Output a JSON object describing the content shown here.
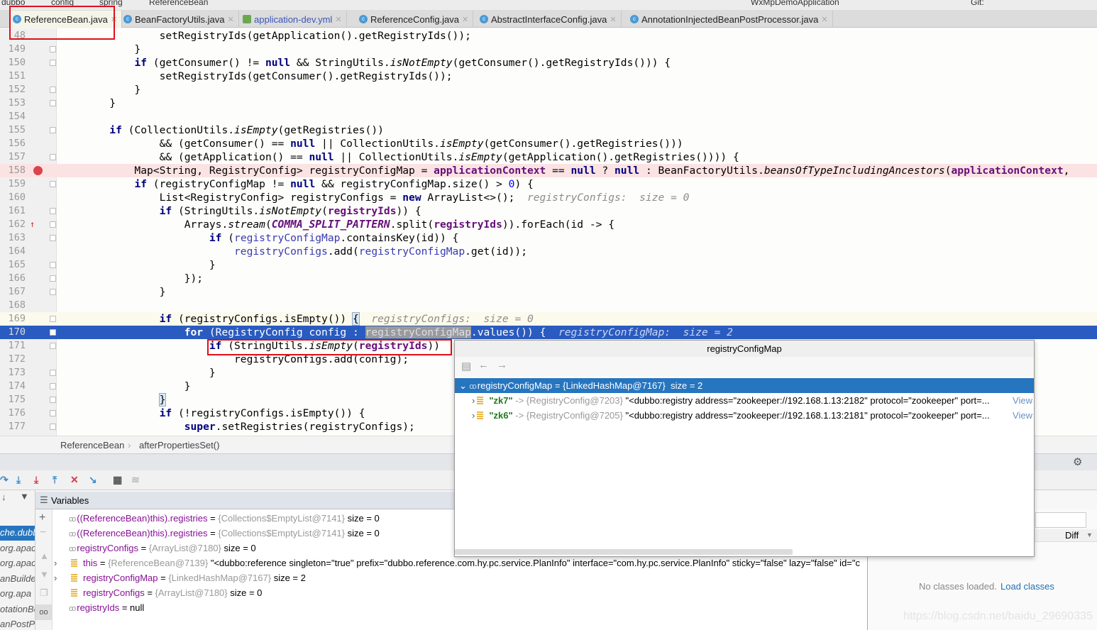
{
  "top_breadcrumb": [
    "dubbo",
    "config",
    "spring",
    "ReferenceBean"
  ],
  "run_config": "WxMpDemoApplication",
  "git_label": "Git:",
  "tabs": [
    {
      "label": "ReferenceBean.java",
      "active": true,
      "type": "class"
    },
    {
      "label": "BeanFactoryUtils.java",
      "type": "class"
    },
    {
      "label": "application-dev.yml",
      "type": "yml"
    },
    {
      "label": "ReferenceConfig.java",
      "type": "class"
    },
    {
      "label": "AbstractInterfaceConfig.java",
      "type": "class"
    },
    {
      "label": "AnnotationInjectedBeanPostProcessor.java",
      "type": "class"
    }
  ],
  "editor": {
    "execution_line": 170,
    "breakpoint_line": 158,
    "caret_line": 169,
    "lines": [
      {
        "n": "48",
        "t": [
          [
            "",
            "                setRegistryIds(getApplication().getRegistryIds());"
          ]
        ]
      },
      {
        "n": "149",
        "t": [
          [
            "",
            "            }"
          ]
        ]
      },
      {
        "n": "150",
        "t": [
          [
            "",
            "            "
          ],
          [
            "k",
            "if"
          ],
          [
            "",
            " (getConsumer() != "
          ],
          [
            "k",
            "null"
          ],
          [
            "",
            " && StringUtils."
          ],
          [
            "i",
            "isNotEmpty"
          ],
          [
            "",
            "(getConsumer().getRegistryIds())) {"
          ]
        ]
      },
      {
        "n": "151",
        "t": [
          [
            "",
            "                setRegistryIds(getConsumer().getRegistryIds());"
          ]
        ]
      },
      {
        "n": "152",
        "t": [
          [
            "",
            "            }"
          ]
        ]
      },
      {
        "n": "153",
        "t": [
          [
            "",
            "        }"
          ]
        ]
      },
      {
        "n": "154",
        "t": []
      },
      {
        "n": "155",
        "t": [
          [
            "",
            "        "
          ],
          [
            "k",
            "if"
          ],
          [
            "",
            " (CollectionUtils."
          ],
          [
            "i",
            "isEmpty"
          ],
          [
            "",
            "(getRegistries())"
          ]
        ]
      },
      {
        "n": "156",
        "t": [
          [
            "",
            "                && (getConsumer() == "
          ],
          [
            "k",
            "null"
          ],
          [
            "",
            " || CollectionUtils."
          ],
          [
            "i",
            "isEmpty"
          ],
          [
            "",
            "(getConsumer().getRegistries()))"
          ]
        ]
      },
      {
        "n": "157",
        "t": [
          [
            "",
            "                && (getApplication() == "
          ],
          [
            "k",
            "null"
          ],
          [
            "",
            " || CollectionUtils."
          ],
          [
            "i",
            "isEmpty"
          ],
          [
            "",
            "(getApplication().getRegistries()))) {"
          ]
        ]
      },
      {
        "n": "158",
        "t": [
          [
            "",
            "            Map<String, RegistryConfig> registryConfigMap = "
          ],
          [
            "f",
            "applicationContext"
          ],
          [
            "",
            " == "
          ],
          [
            "k",
            "null"
          ],
          [
            "",
            " ? "
          ],
          [
            "k",
            "null"
          ],
          [
            "",
            " : BeanFactoryUtils."
          ],
          [
            "i",
            "beansOfTypeIncludingAncestors"
          ],
          [
            "",
            "("
          ],
          [
            "f",
            "applicationContext"
          ],
          [
            "",
            ","
          ]
        ]
      },
      {
        "n": "159",
        "t": [
          [
            "",
            "            "
          ],
          [
            "k",
            "if"
          ],
          [
            "",
            " (registryConfigMap != "
          ],
          [
            "k",
            "null"
          ],
          [
            "",
            " && registryConfigMap.size() > "
          ],
          [
            "n",
            "0"
          ],
          [
            "",
            ") {"
          ]
        ]
      },
      {
        "n": "160",
        "t": [
          [
            "",
            "                List<RegistryConfig> registryConfigs = "
          ],
          [
            "k",
            "new"
          ],
          [
            "",
            " ArrayList<>();  "
          ],
          [
            "h",
            "registryConfigs:  size = 0"
          ]
        ]
      },
      {
        "n": "161",
        "t": [
          [
            "",
            "                "
          ],
          [
            "k",
            "if"
          ],
          [
            "",
            " (StringUtils."
          ],
          [
            "i",
            "isNotEmpty"
          ],
          [
            "",
            "("
          ],
          [
            "f",
            "registryIds"
          ],
          [
            "",
            ")) {"
          ]
        ]
      },
      {
        "n": "162",
        "t": [
          [
            "",
            "                    Arrays."
          ],
          [
            "i",
            "stream"
          ],
          [
            "",
            "("
          ],
          [
            "c",
            "COMMA_SPLIT_PATTERN"
          ],
          [
            "",
            ".split("
          ],
          [
            "f",
            "registryIds"
          ],
          [
            "",
            ")).forEach(id -> {"
          ]
        ]
      },
      {
        "n": "163",
        "t": [
          [
            "",
            "                        "
          ],
          [
            "k",
            "if"
          ],
          [
            "",
            " ("
          ],
          [
            "cap",
            "registryConfigMap"
          ],
          [
            "",
            ".containsKey(id)) {"
          ]
        ]
      },
      {
        "n": "164",
        "t": [
          [
            "",
            "                            "
          ],
          [
            "cap",
            "registryConfigs"
          ],
          [
            "",
            ".add("
          ],
          [
            "cap",
            "registryConfigMap"
          ],
          [
            "",
            ".get(id));"
          ]
        ]
      },
      {
        "n": "165",
        "t": [
          [
            "",
            "                        }"
          ]
        ]
      },
      {
        "n": "166",
        "t": [
          [
            "",
            "                    });"
          ]
        ]
      },
      {
        "n": "167",
        "t": [
          [
            "",
            "                }"
          ]
        ]
      },
      {
        "n": "168",
        "t": []
      },
      {
        "n": "169",
        "t": [
          [
            "",
            "                "
          ],
          [
            "k",
            "if"
          ],
          [
            "",
            " (registryConfigs.isEmpty()) "
          ],
          [
            "brace",
            "{"
          ],
          [
            "",
            "  "
          ],
          [
            "h",
            "registryConfigs:  size = 0"
          ]
        ]
      },
      {
        "n": "170",
        "t": [
          [
            "",
            "                    "
          ],
          [
            "k",
            "for"
          ],
          [
            "",
            " (RegistryConfig config : "
          ],
          [
            "sel",
            "registryConfigMap"
          ],
          [
            "",
            ".values()) {  "
          ],
          [
            "h",
            "registryConfigMap:  size = 2"
          ]
        ]
      },
      {
        "n": "171",
        "t": [
          [
            "",
            "                        "
          ],
          [
            "k",
            "if"
          ],
          [
            "",
            " (StringUtils."
          ],
          [
            "i",
            "isEmpty"
          ],
          [
            "",
            "("
          ],
          [
            "f",
            "registryIds"
          ],
          [
            "",
            "))"
          ]
        ]
      },
      {
        "n": "172",
        "t": [
          [
            "",
            "                            registryConfigs.add(config);"
          ]
        ]
      },
      {
        "n": "173",
        "t": [
          [
            "",
            "                        }"
          ]
        ]
      },
      {
        "n": "174",
        "t": [
          [
            "",
            "                    }"
          ]
        ]
      },
      {
        "n": "175",
        "t": [
          [
            "",
            "                "
          ],
          [
            "brace",
            "}"
          ]
        ]
      },
      {
        "n": "176",
        "t": [
          [
            "",
            "                "
          ],
          [
            "k",
            "if"
          ],
          [
            "",
            " (!registryConfigs.isEmpty()) {"
          ]
        ]
      },
      {
        "n": "177",
        "t": [
          [
            "",
            "                    "
          ],
          [
            "k",
            "super"
          ],
          [
            "",
            ".setRegistries(registryConfigs);"
          ]
        ]
      }
    ]
  },
  "breadcrumb": {
    "class": "ReferenceBean",
    "method": "afterPropertiesSet()"
  },
  "frames": [
    "che.dubb",
    "org.apac",
    "org.apach",
    "anBuilde",
    "org.apa",
    "otationBe",
    "anPostPr"
  ],
  "variables": {
    "title": "Variables",
    "rows": [
      {
        "icon": "watch",
        "name": "((ReferenceBean)this).registries",
        "type": "{Collections$EmptyList@7141}",
        "value": "size = 0"
      },
      {
        "icon": "watch",
        "name": "((ReferenceBean)this).registries",
        "type": "{Collections$EmptyList@7141}",
        "value": "size = 0"
      },
      {
        "icon": "watch",
        "name": "registryConfigs",
        "type": "{ArrayList@7180}",
        "value": "size = 0"
      },
      {
        "icon": "field",
        "expandable": true,
        "name": "this",
        "type": "{ReferenceBean@7139}",
        "value": "\"<dubbo:reference singleton=\"true\" prefix=\"dubbo.reference.com.hy.pc.service.PlanInfo\" interface=\"com.hy.pc.service.PlanInfo\" sticky=\"false\" lazy=\"false\" id=\"c"
      },
      {
        "icon": "field",
        "expandable": true,
        "name": "registryConfigMap",
        "type": "{LinkedHashMap@7167}",
        "value": "size = 2"
      },
      {
        "icon": "field",
        "name": "registryConfigs",
        "type": "{ArrayList@7180}",
        "value": "size = 0"
      },
      {
        "icon": "watch",
        "name": "registryIds",
        "type": "",
        "value": "null"
      }
    ]
  },
  "popup": {
    "title": "registryConfigMap",
    "root": {
      "name": "registryConfigMap",
      "type": "{LinkedHashMap@7167}",
      "value": "size = 2"
    },
    "entries": [
      {
        "key": "\"zk7\"",
        "type": "{RegistryConfig@7203}",
        "value": "\"<dubbo:registry address=\"zookeeper://192.168.1.13:2182\" protocol=\"zookeeper\" port=...",
        "link": "View"
      },
      {
        "key": "\"zk6\"",
        "type": "{RegistryConfig@7205}",
        "value": "\"<dubbo:registry address=\"zookeeper://192.168.1.13:2181\" protocol=\"zookeeper\" port=...",
        "link": "View"
      }
    ]
  },
  "right_panel": {
    "diff_label": "Diff",
    "empty_text": "No classes loaded.",
    "load_link": "Load classes"
  },
  "watermark": "https://blog.csdn.net/baidu_29690335",
  "colors": {
    "execution_line": "#2a5bc0",
    "highlight_box": "#e0101a",
    "popup_selection": "#2675bf"
  }
}
